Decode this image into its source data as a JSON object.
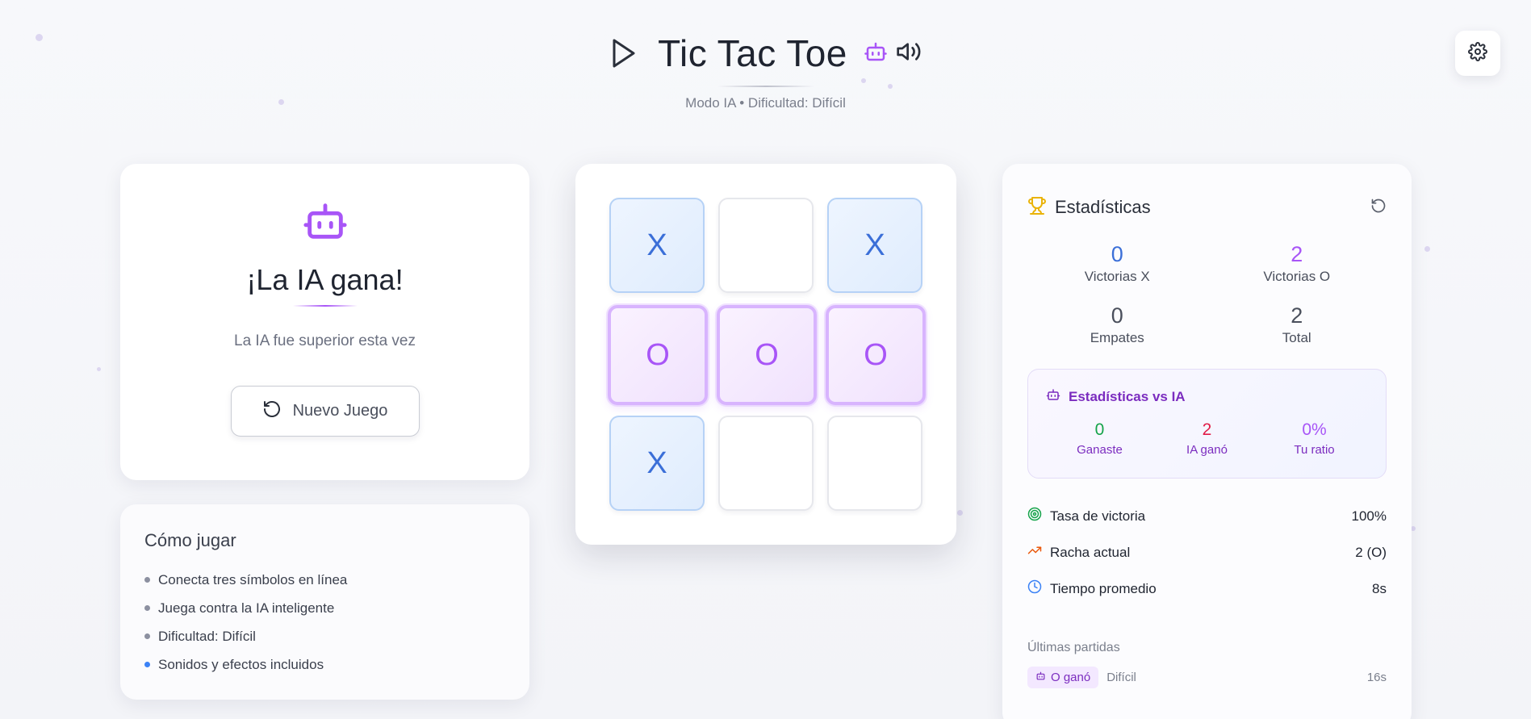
{
  "header": {
    "title": "Tic Tac Toe",
    "subtitle": "Modo IA • Dificultad: Difícil"
  },
  "result": {
    "title": "¡La IA gana!",
    "message": "La IA fue superior esta vez",
    "new_game_label": "Nuevo Juego"
  },
  "howto": {
    "title": "Cómo jugar",
    "items": [
      "Conecta tres símbolos en línea",
      "Juega contra la IA inteligente",
      "Dificultad: Difícil",
      "Sonidos y efectos incluidos"
    ]
  },
  "board": {
    "cells": [
      "X",
      "",
      "X",
      "O",
      "O",
      "O",
      "X",
      "",
      ""
    ],
    "winning_line": [
      3,
      4,
      5
    ]
  },
  "stats": {
    "title": "Estadísticas",
    "wins_x": {
      "value": "0",
      "label": "Victorias X"
    },
    "wins_o": {
      "value": "2",
      "label": "Victorias O"
    },
    "draws": {
      "value": "0",
      "label": "Empates"
    },
    "total": {
      "value": "2",
      "label": "Total"
    },
    "ai": {
      "title": "Estadísticas vs IA",
      "you_won": {
        "value": "0",
        "label": "Ganaste"
      },
      "ai_won": {
        "value": "2",
        "label": "IA ganó"
      },
      "ratio": {
        "value": "0%",
        "label": "Tu ratio"
      }
    },
    "win_rate": {
      "label": "Tasa de victoria",
      "value": "100%"
    },
    "streak": {
      "label": "Racha actual",
      "value": "2 (O)"
    },
    "avg_time": {
      "label": "Tiempo promedio",
      "value": "8s"
    },
    "recent": {
      "title": "Últimas partidas",
      "items": [
        {
          "result": "O ganó",
          "difficulty": "Difícil",
          "time": "16s"
        }
      ]
    }
  },
  "colors": {
    "accent_purple": "#a855f7",
    "accent_blue": "#3b6fd8",
    "win_green": "#16a34a",
    "loss_red": "#e11d48",
    "trophy": "#eab308"
  }
}
